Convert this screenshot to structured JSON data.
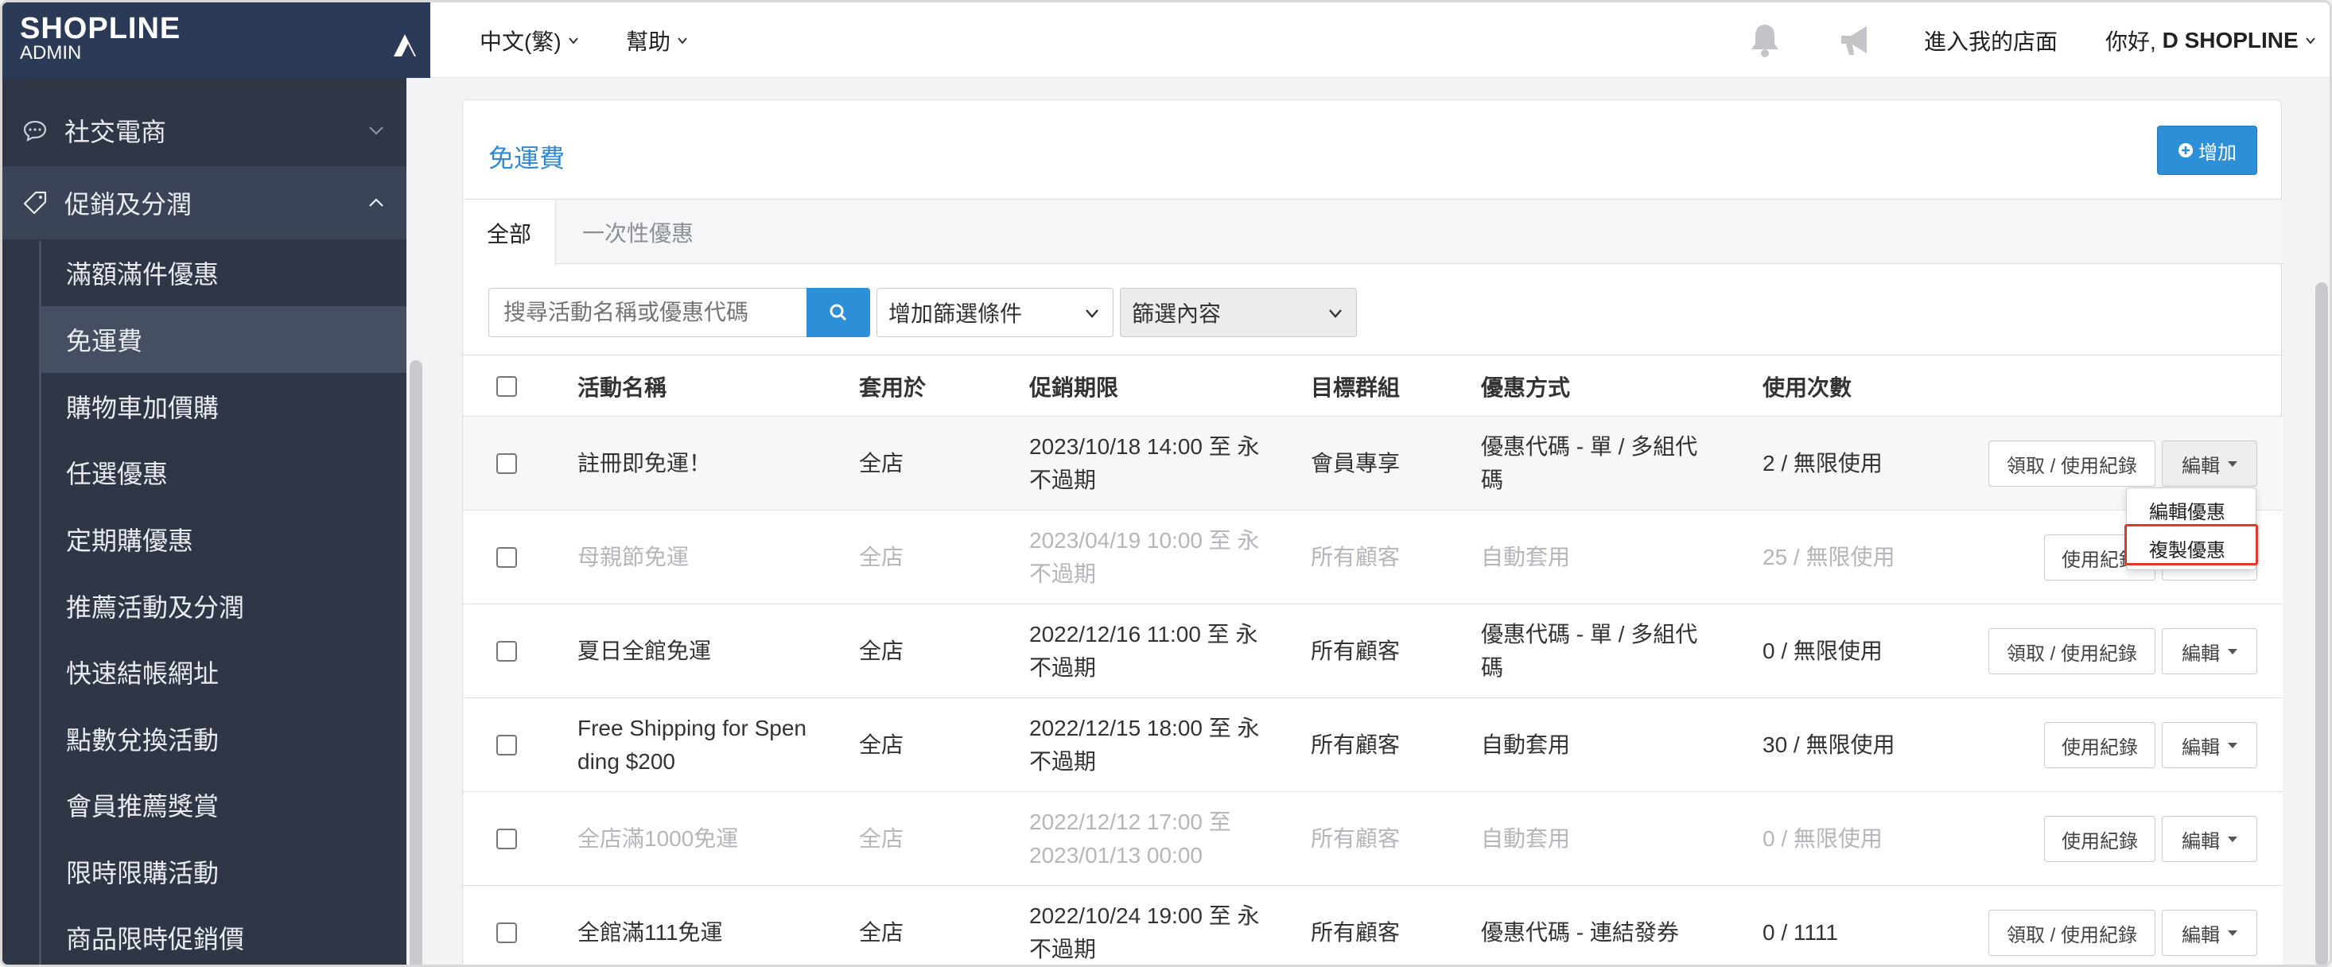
{
  "brand": {
    "name": "SHOPLINE",
    "sub": "ADMIN"
  },
  "sidebar": {
    "groups": [
      {
        "label": "社交電商",
        "expanded": false
      },
      {
        "label": "促銷及分潤",
        "expanded": true
      }
    ],
    "items": [
      {
        "label": "滿額滿件優惠"
      },
      {
        "label": "免運費",
        "active": true
      },
      {
        "label": "購物車加價購"
      },
      {
        "label": "任選優惠"
      },
      {
        "label": "定期購優惠"
      },
      {
        "label": "推薦活動及分潤"
      },
      {
        "label": "快速結帳網址"
      },
      {
        "label": "點數兌換活動"
      },
      {
        "label": "會員推薦獎賞"
      },
      {
        "label": "限時限購活動"
      },
      {
        "label": "商品限時促銷價"
      }
    ]
  },
  "topbar": {
    "language": "中文(繁)",
    "help": "幫助",
    "store_link": "進入我的店面",
    "greeting_prefix": "你好, ",
    "greeting_name": "D SHOPLINE"
  },
  "panel": {
    "title": "免運費",
    "add_label": "增加",
    "tabs": [
      {
        "label": "全部"
      },
      {
        "label": "一次性優惠"
      }
    ],
    "search": {
      "placeholder": "搜尋活動名稱或優惠代碼"
    },
    "filter_add": "增加篩選條件",
    "filter_content": "篩選內容"
  },
  "table": {
    "headers": {
      "name": "活動名稱",
      "applies": "套用於",
      "period": "促銷期限",
      "target": "目標群組",
      "method": "優惠方式",
      "usage": "使用次數"
    },
    "rows": [
      {
        "name": "註冊即免運！",
        "applies": "全店",
        "period": "2023/10/18 14:00 至 永不過期",
        "target": "會員專享",
        "method": "優惠代碼 - 單 / 多組代碼",
        "usage": "2 / 無限使用",
        "action": "領取 / 使用紀錄",
        "edit": "編輯",
        "dim": false
      },
      {
        "name": "母親節免運",
        "applies": "全店",
        "period": "2023/04/19 10:00 至 永不過期",
        "target": "所有顧客",
        "method": "自動套用",
        "usage": "25 / 無限使用",
        "action": "使用紀錄",
        "edit": "編輯",
        "dim": true
      },
      {
        "name": "夏日全館免運",
        "applies": "全店",
        "period": "2022/12/16 11:00 至 永不過期",
        "target": "所有顧客",
        "method": "優惠代碼 - 單 / 多組代碼",
        "usage": "0 / 無限使用",
        "action": "領取 / 使用紀錄",
        "edit": "編輯",
        "dim": false
      },
      {
        "name": "Free Shipping for Spending $200",
        "applies": "全店",
        "period": "2022/12/15 18:00 至 永不過期",
        "target": "所有顧客",
        "method": "自動套用",
        "usage": "30 / 無限使用",
        "action": "使用紀錄",
        "edit": "編輯",
        "dim": false
      },
      {
        "name": "全店滿1000免運",
        "applies": "全店",
        "period": "2022/12/12 17:00 至 2023/01/13 00:00",
        "target": "所有顧客",
        "method": "自動套用",
        "usage": "0 / 無限使用",
        "action": "使用紀錄",
        "edit": "編輯",
        "dim": true
      },
      {
        "name": "全館滿111免運",
        "applies": "全店",
        "period": "2022/10/24 19:00 至 永不過期",
        "target": "所有顧客",
        "method": "優惠代碼 - 連結發券",
        "usage": "0 / 1111",
        "action": "領取 / 使用紀錄",
        "edit": "編輯",
        "dim": false
      }
    ]
  },
  "dropdown": {
    "items": [
      {
        "label": "編輯優惠"
      },
      {
        "label": "複製優惠"
      }
    ]
  },
  "colors": {
    "sidebar_bg": "#2f3747",
    "accent": "#2e8fd9",
    "highlight_border": "#e0392c"
  }
}
